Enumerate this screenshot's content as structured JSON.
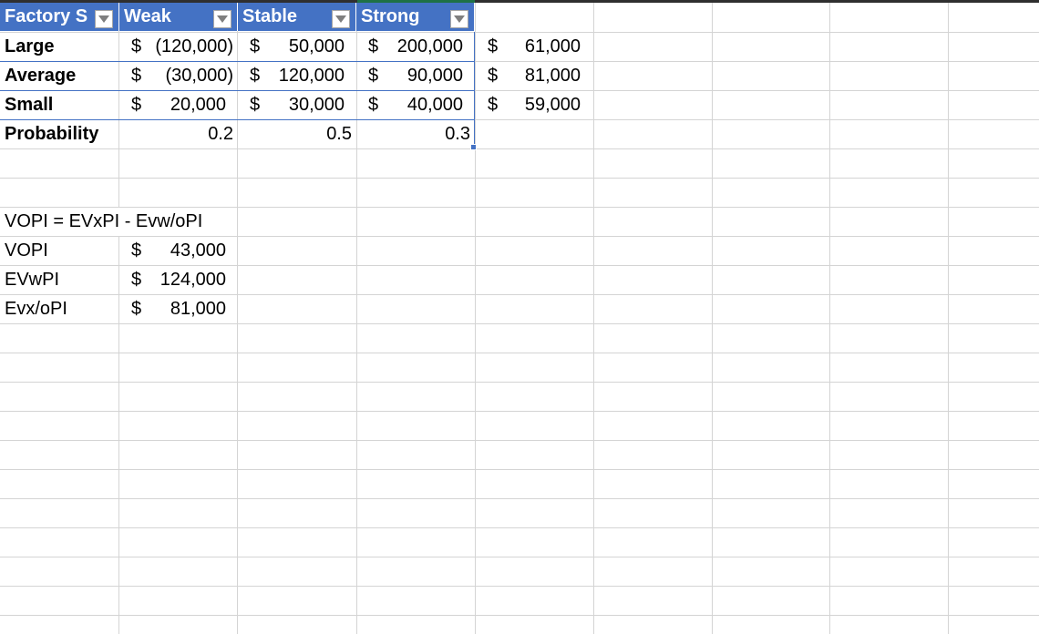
{
  "table": {
    "headers": [
      "Factory S",
      "Weak",
      "Stable",
      "Strong"
    ],
    "rows": [
      {
        "label": "Large",
        "weak": "(120,000)",
        "stable": "50,000",
        "strong": "200,000",
        "ev": "61,000"
      },
      {
        "label": "Average",
        "weak": "(30,000)",
        "stable": "120,000",
        "strong": "90,000",
        "ev": "81,000"
      },
      {
        "label": "Small",
        "weak": "20,000",
        "stable": "30,000",
        "strong": "40,000",
        "ev": "59,000"
      }
    ],
    "probability": {
      "label": "Probability",
      "weak": "0.2",
      "stable": "0.5",
      "strong": "0.3"
    },
    "currency_symbol": "$"
  },
  "summary": {
    "formula": "VOPI = EVxPI - Evw/oPI",
    "items": [
      {
        "label": "VOPI",
        "value": "43,000"
      },
      {
        "label": "EVwPI",
        "value": "124,000"
      },
      {
        "label": "Evx/oPI",
        "value": "81,000"
      }
    ]
  }
}
